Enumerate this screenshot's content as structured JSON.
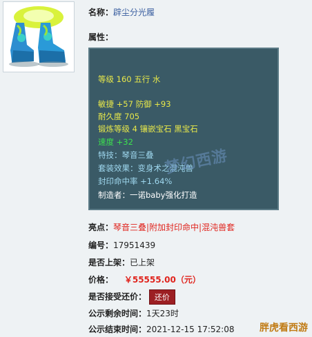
{
  "item": {
    "name_label": "名称：",
    "name_value": "辟尘分光履",
    "attr_label": "属性："
  },
  "attributes": {
    "line1": "等级 160 五行 水",
    "line2": "敏捷 +57 防御 +93",
    "line3": "耐久度 705",
    "line4": "锻炼等级 4 镶嵌宝石 黑宝石",
    "line5": "速度 +32",
    "line6": "特技：琴音三叠",
    "line7": "套装效果：变身术之混沌兽",
    "line8": "封印命中率 +1.64%",
    "line9": "制造者：一诺baby强化打造",
    "watermark": "梦幻西游"
  },
  "details": {
    "highlight_label": "亮点：",
    "highlight_value": "琴音三叠|附加封印命中|混沌兽套",
    "serial_label": "编号：",
    "serial_value": "17951439",
    "listed_label": "是否上架：",
    "listed_value": "已上架",
    "price_label": "价格：",
    "price_value": "￥55555.00（元）",
    "bargain_label": "是否接受还价：",
    "bargain_button": "还价",
    "remaining_label": "公示剩余时间：",
    "remaining_value": "1天23时",
    "end_label": "公示结束时间：",
    "end_value": "2021-12-15 17:52:08"
  },
  "corner_watermark": "胖虎看西游",
  "colors": {
    "info_bg": "#3a5a66",
    "yellow": "#e8e84a",
    "green": "#3de24e",
    "cyan": "#9fd8ef",
    "red": "#e0241d",
    "button": "#9c1f23"
  }
}
